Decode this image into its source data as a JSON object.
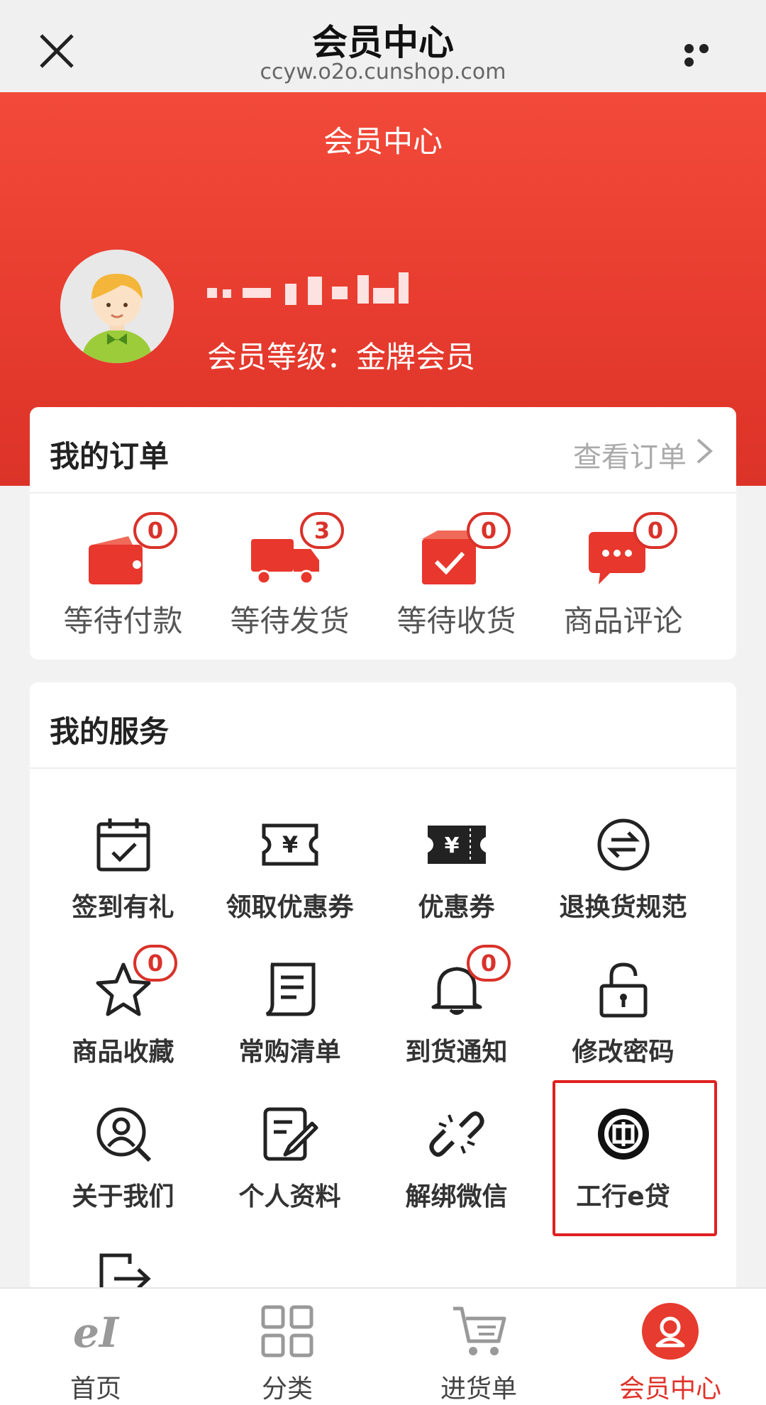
{
  "browser": {
    "title": "会员中心",
    "url": "ccyw.o2o.cunshop.com"
  },
  "header": {
    "title": "会员中心",
    "level_text": "会员等级：金牌会员"
  },
  "orders": {
    "heading": "我的订单",
    "view_all": "查看订单",
    "items": [
      {
        "label": "等待付款",
        "count": "0",
        "icon": "wallet-icon"
      },
      {
        "label": "等待发货",
        "count": "3",
        "icon": "truck-icon"
      },
      {
        "label": "等待收货",
        "count": "0",
        "icon": "package-icon"
      },
      {
        "label": "商品评论",
        "count": "0",
        "icon": "chat-icon"
      }
    ]
  },
  "services": {
    "heading": "我的服务",
    "items": [
      {
        "label": "签到有礼",
        "icon": "calendar-check-icon"
      },
      {
        "label": "领取优惠券",
        "icon": "coupon-outline-icon"
      },
      {
        "label": "优惠券",
        "icon": "coupon-filled-icon"
      },
      {
        "label": "退换货规范",
        "icon": "exchange-icon"
      },
      {
        "label": "商品收藏",
        "icon": "star-icon",
        "count": "0"
      },
      {
        "label": "常购清单",
        "icon": "scroll-list-icon"
      },
      {
        "label": "到货通知",
        "icon": "bell-icon",
        "count": "0"
      },
      {
        "label": "修改密码",
        "icon": "lock-icon"
      },
      {
        "label": "关于我们",
        "icon": "user-search-icon"
      },
      {
        "label": "个人资料",
        "icon": "edit-profile-icon"
      },
      {
        "label": "解绑微信",
        "icon": "unlink-icon"
      },
      {
        "label": "工行e贷",
        "icon": "icbc-logo-icon"
      }
    ]
  },
  "tabs": [
    {
      "label": "首页",
      "icon": "home-logo-icon"
    },
    {
      "label": "分类",
      "icon": "grid-icon"
    },
    {
      "label": "进货单",
      "icon": "cart-icon"
    },
    {
      "label": "会员中心",
      "icon": "member-icon",
      "active": true
    }
  ],
  "colors": {
    "brand_red": "#e63b2e",
    "badge_red": "#d9322a",
    "highlight_box": "#e02020"
  }
}
